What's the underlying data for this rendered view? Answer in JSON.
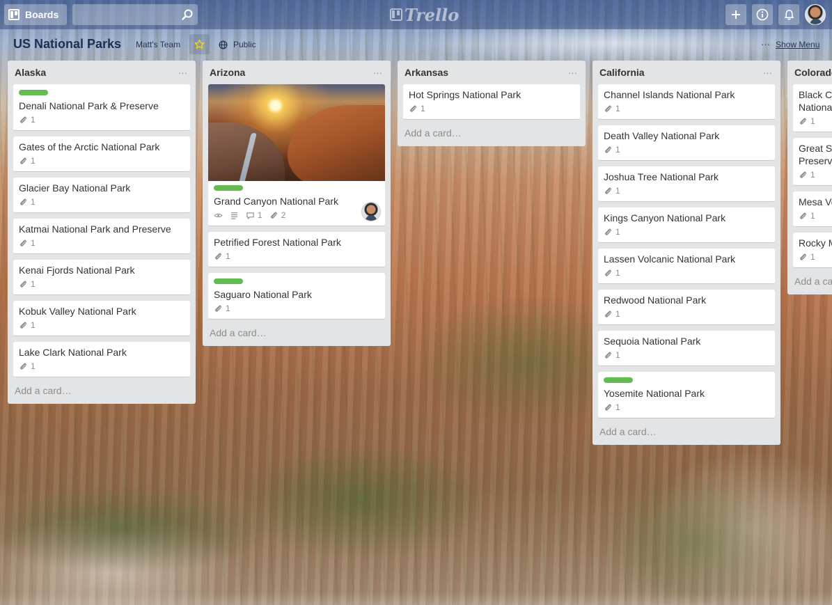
{
  "header": {
    "boards_label": "Boards",
    "search_placeholder": "",
    "logo_text": "Trello",
    "icons": [
      "board-icon",
      "search-icon",
      "plus-icon",
      "info-icon",
      "bell-icon"
    ]
  },
  "board": {
    "title": "US National Parks",
    "team": "Matt's Team",
    "visibility": "Public",
    "menu_dots": "···",
    "show_menu": "Show Menu",
    "starred_color": "#f2d600"
  },
  "colors": {
    "label_green": "#61bd4f",
    "list_bg": "#e2e4e6"
  },
  "add_card_text": "Add a card…",
  "list_menu_text": "···",
  "lists": [
    {
      "name": "Alaska",
      "cards": [
        {
          "title": "Denali National Park & Preserve",
          "label": true,
          "attachments": "1"
        },
        {
          "title": "Gates of the Arctic National Park",
          "attachments": "1"
        },
        {
          "title": "Glacier Bay National Park",
          "attachments": "1"
        },
        {
          "title": "Katmai National Park and Preserve",
          "attachments": "1"
        },
        {
          "title": "Kenai Fjords National Park",
          "attachments": "1"
        },
        {
          "title": "Kobuk Valley National Park",
          "attachments": "1"
        },
        {
          "title": "Lake Clark National Park",
          "attachments": "1"
        }
      ]
    },
    {
      "name": "Arizona",
      "cards": [
        {
          "title": "Grand Canyon National Park",
          "label": true,
          "cover": true,
          "watching": true,
          "description": true,
          "comments": "1",
          "attachments": "2",
          "member": true
        },
        {
          "title": "Petrified Forest National Park",
          "attachments": "1"
        },
        {
          "title": "Saguaro National Park",
          "label": true,
          "attachments": "1"
        }
      ]
    },
    {
      "name": "Arkansas",
      "cards": [
        {
          "title": "Hot Springs National Park",
          "attachments": "1"
        }
      ]
    },
    {
      "name": "California",
      "cards": [
        {
          "title": "Channel Islands National Park",
          "attachments": "1"
        },
        {
          "title": "Death Valley National Park",
          "attachments": "1"
        },
        {
          "title": "Joshua Tree National Park",
          "attachments": "1"
        },
        {
          "title": "Kings Canyon National Park",
          "attachments": "1"
        },
        {
          "title": "Lassen Volcanic National Park",
          "attachments": "1"
        },
        {
          "title": "Redwood National Park",
          "attachments": "1"
        },
        {
          "title": "Sequoia National Park",
          "attachments": "1"
        },
        {
          "title": "Yosemite National Park",
          "label": true,
          "attachments": "1"
        }
      ]
    },
    {
      "name": "Colorado",
      "cards": [
        {
          "title": "Black Canyon of the Gunnison National Park",
          "attachments": "1"
        },
        {
          "title": "Great Sand Dunes National Park and Preserve",
          "attachments": "1"
        },
        {
          "title": "Mesa Verde National Park",
          "attachments": "1"
        },
        {
          "title": "Rocky Mountain National Park",
          "attachments": "1"
        }
      ]
    }
  ]
}
